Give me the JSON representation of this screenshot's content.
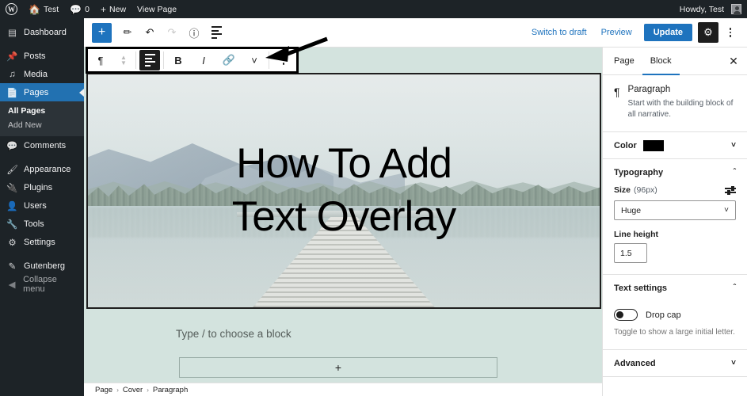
{
  "adminbar": {
    "logo_icon": "wordpress-logo",
    "site_icon": "home-icon",
    "site_name": "Test",
    "comments_icon": "comment-icon",
    "comments_count": "0",
    "new_icon": "plus-icon",
    "new_label": "New",
    "view_page_label": "View Page",
    "howdy": "Howdy, Test"
  },
  "adminmenu": {
    "items": [
      {
        "label": "Dashboard",
        "icon": "dashboard-icon",
        "state": "normal"
      },
      {
        "label": "Posts",
        "icon": "pin-icon",
        "state": "normal"
      },
      {
        "label": "Media",
        "icon": "media-icon",
        "state": "normal"
      },
      {
        "label": "Pages",
        "icon": "pages-icon",
        "state": "current"
      },
      {
        "label": "Comments",
        "icon": "comment-icon",
        "state": "normal"
      },
      {
        "label": "Appearance",
        "icon": "brush-icon",
        "state": "normal"
      },
      {
        "label": "Plugins",
        "icon": "plug-icon",
        "state": "normal"
      },
      {
        "label": "Users",
        "icon": "user-icon",
        "state": "normal"
      },
      {
        "label": "Tools",
        "icon": "wrench-icon",
        "state": "normal"
      },
      {
        "label": "Settings",
        "icon": "settings-icon",
        "state": "normal"
      },
      {
        "label": "Gutenberg",
        "icon": "pencil-icon",
        "state": "normal"
      },
      {
        "label": "Collapse menu",
        "icon": "collapse-icon",
        "state": "dim"
      }
    ],
    "pages_submenu": [
      {
        "label": "All Pages",
        "current": true
      },
      {
        "label": "Add New",
        "current": false
      }
    ]
  },
  "header": {
    "add_block_icon": "plus-icon",
    "tools_icon": "pencil-icon",
    "undo_icon": "undo-icon",
    "redo_icon": "redo-icon",
    "info_icon": "info-icon",
    "list_view_icon": "list-view-icon",
    "switch_to_draft": "Switch to draft",
    "preview": "Preview",
    "update": "Update",
    "settings_icon": "gear-icon",
    "more_icon": "more-vertical-icon"
  },
  "block_toolbar": {
    "block_type_icon": "paragraph-icon",
    "block_type_glyph": "¶",
    "movers_icon": "move-up-down-icon",
    "align_icon": "align-text-icon",
    "bold_label": "B",
    "italic_label": "I",
    "link_icon": "link-icon",
    "more_formats_icon": "chevron-down-icon",
    "options_icon": "more-vertical-icon"
  },
  "annotation": {
    "arrow_icon": "arrow-pointer-left-icon"
  },
  "canvas": {
    "cover": {
      "line1": "How To Add",
      "line2": "Text Overlay",
      "image_alt": "lake-dock-mountains-photo"
    },
    "paragraph_placeholder": "Type / to choose a block",
    "appender_icon": "plus-icon",
    "appender_label": "+"
  },
  "breadcrumb": {
    "items": [
      "Page",
      "Cover",
      "Paragraph"
    ],
    "separator": "›"
  },
  "settings": {
    "tabs": [
      {
        "label": "Page",
        "active": false
      },
      {
        "label": "Block",
        "active": true
      }
    ],
    "close_icon": "close-icon",
    "block": {
      "icon": "paragraph-icon",
      "glyph": "¶",
      "title": "Paragraph",
      "description": "Start with the building block of all narrative."
    },
    "color": {
      "label": "Color",
      "swatch": "#000000",
      "chevron_icon": "chevron-down-icon"
    },
    "typography": {
      "label": "Typography",
      "chevron_icon": "chevron-up-icon",
      "size_label": "Size",
      "size_value_hint": "(96px)",
      "size_settings_icon": "sliders-icon",
      "size_preset": "Huge",
      "size_preset_chevron": "chevron-down-icon",
      "line_height_label": "Line height",
      "line_height_value": "1.5"
    },
    "text_settings": {
      "label": "Text settings",
      "chevron_icon": "chevron-up-icon",
      "drop_cap_label": "Drop cap",
      "drop_cap_on": false,
      "drop_cap_help": "Toggle to show a large initial letter."
    },
    "advanced": {
      "label": "Advanced",
      "chevron_icon": "chevron-down-icon"
    }
  },
  "colors": {
    "admin_dark": "#1d2327",
    "admin_current": "#2271b1",
    "accent_blue": "#1e73be",
    "canvas_bg": "#d3e3de"
  }
}
